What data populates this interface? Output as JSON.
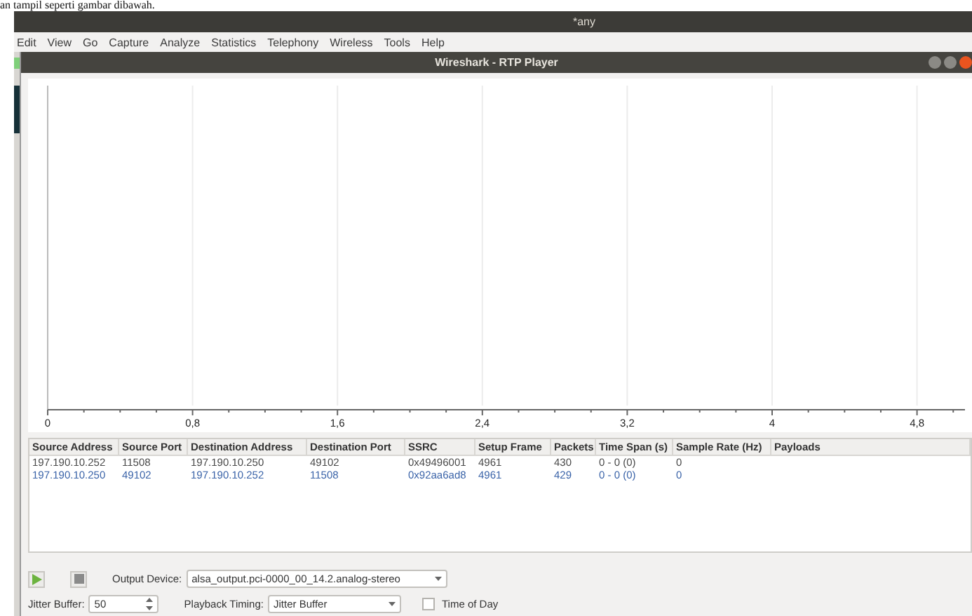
{
  "document_text": "an tampil seperti gambar dibawah.",
  "main_window": {
    "title": "*any",
    "menu": [
      "Edit",
      "View",
      "Go",
      "Capture",
      "Analyze",
      "Statistics",
      "Telephony",
      "Wireless",
      "Tools",
      "Help"
    ]
  },
  "dialog": {
    "title": "Wireshark - RTP Player",
    "plot": {
      "x_tick_labels": [
        "0",
        "0,8",
        "1,6",
        "2,4",
        "3,2",
        "4",
        "4,8"
      ]
    },
    "table": {
      "columns": [
        "Source Address",
        "Source Port",
        "Destination Address",
        "Destination Port",
        "SSRC",
        "Setup Frame",
        "Packets",
        "Time Span (s)",
        "Sample Rate (Hz)",
        "Payloads"
      ],
      "rows": [
        {
          "color": "#4a4a4a",
          "cells": [
            "197.190.10.252",
            "11508",
            "197.190.10.250",
            "49102",
            "0x49496001",
            "4961",
            "430",
            "0 - 0 (0)",
            "0",
            ""
          ]
        },
        {
          "color": "#3a63a8",
          "cells": [
            "197.190.10.250",
            "49102",
            "197.190.10.252",
            "11508",
            "0x92aa6ad8",
            "4961",
            "429",
            "0 - 0 (0)",
            "0",
            ""
          ]
        }
      ]
    },
    "output_device": {
      "label": "Output Device:",
      "value": "alsa_output.pci-0000_00_14.2.analog-stereo"
    },
    "jitter_buffer": {
      "label": "Jitter Buffer:",
      "value": "50"
    },
    "playback_timing": {
      "label": "Playback Timing:",
      "value": "Jitter Buffer"
    },
    "time_of_day": {
      "label": "Time of Day",
      "checked": false
    }
  }
}
